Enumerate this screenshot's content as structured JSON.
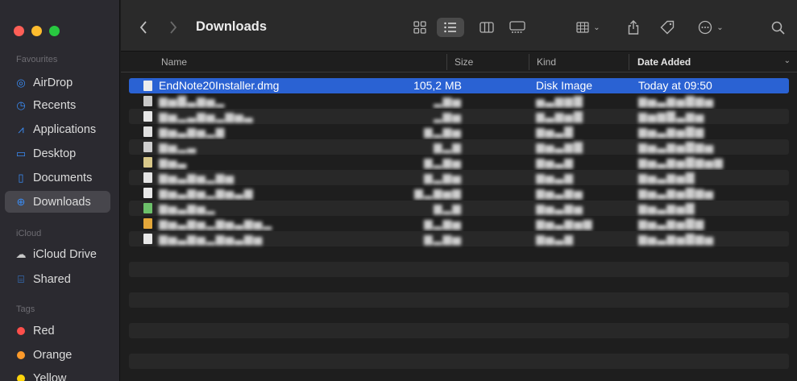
{
  "window": {
    "title": "Downloads"
  },
  "sidebar": {
    "favourites_label": "Favourites",
    "items": [
      {
        "label": "AirDrop",
        "icon": "airdrop-icon"
      },
      {
        "label": "Recents",
        "icon": "clock-icon"
      },
      {
        "label": "Applications",
        "icon": "applications-icon"
      },
      {
        "label": "Desktop",
        "icon": "desktop-icon"
      },
      {
        "label": "Documents",
        "icon": "document-icon"
      },
      {
        "label": "Downloads",
        "icon": "download-icon",
        "active": true
      }
    ],
    "icloud_label": "iCloud",
    "icloud_items": [
      {
        "label": "iCloud Drive",
        "icon": "cloud-icon"
      },
      {
        "label": "Shared",
        "icon": "shared-folder-icon"
      }
    ],
    "tags_label": "Tags",
    "tags": [
      {
        "label": "Red",
        "color": "#fe4f4b"
      },
      {
        "label": "Orange",
        "color": "#fd9a2a"
      },
      {
        "label": "Yellow",
        "color": "#fcd40c"
      }
    ]
  },
  "columns": {
    "name": "Name",
    "size": "Size",
    "kind": "Kind",
    "date": "Date Added"
  },
  "files": [
    {
      "name": "EndNote20Installer.dmg",
      "size": "105,2 MB",
      "kind": "Disk Image",
      "date": "Today at 09:50",
      "selected": true
    }
  ],
  "accent": "#2a62d3"
}
